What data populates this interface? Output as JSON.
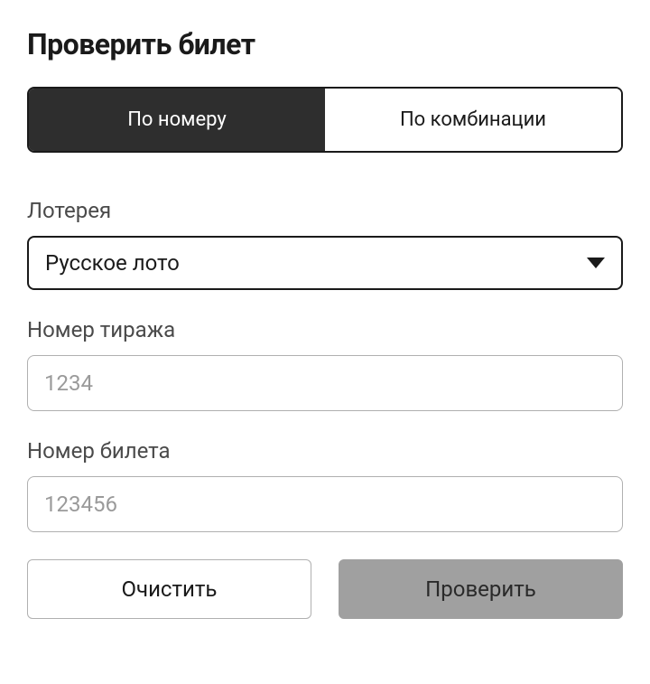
{
  "title": "Проверить билет",
  "tabs": {
    "by_number": "По номеру",
    "by_combination": "По комбинации"
  },
  "lottery": {
    "label": "Лотерея",
    "selected": "Русское лото"
  },
  "draw_number": {
    "label": "Номер тиража",
    "placeholder": "1234",
    "value": ""
  },
  "ticket_number": {
    "label": "Номер билета",
    "placeholder": "123456",
    "value": ""
  },
  "buttons": {
    "clear": "Очистить",
    "check": "Проверить"
  }
}
